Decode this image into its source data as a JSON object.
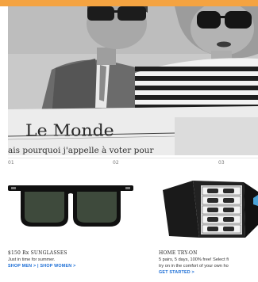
{
  "hero": {
    "newspaper_title": "Le Monde",
    "newspaper_line": "ais pourquoi j'appelle à voter pour"
  },
  "slide_numbers": [
    "01",
    "02",
    "03"
  ],
  "products": [
    {
      "title": "$150 Rx SUNGLASSES",
      "subtitle": "Just in time for summer.",
      "link_men": "SHOP MEN",
      "separator": "|",
      "link_women": "SHOP WOMEN",
      "link_arrow": ">"
    },
    {
      "title": "HOME TRY-ON",
      "line1": "5 pairs, 5 days, 100% free! Select fi",
      "line2": "try on in the comfort of your own ho",
      "cta": "GET STARTED >"
    }
  ],
  "colors": {
    "top_strip": "#f4a341",
    "link": "#1a6dd6"
  }
}
